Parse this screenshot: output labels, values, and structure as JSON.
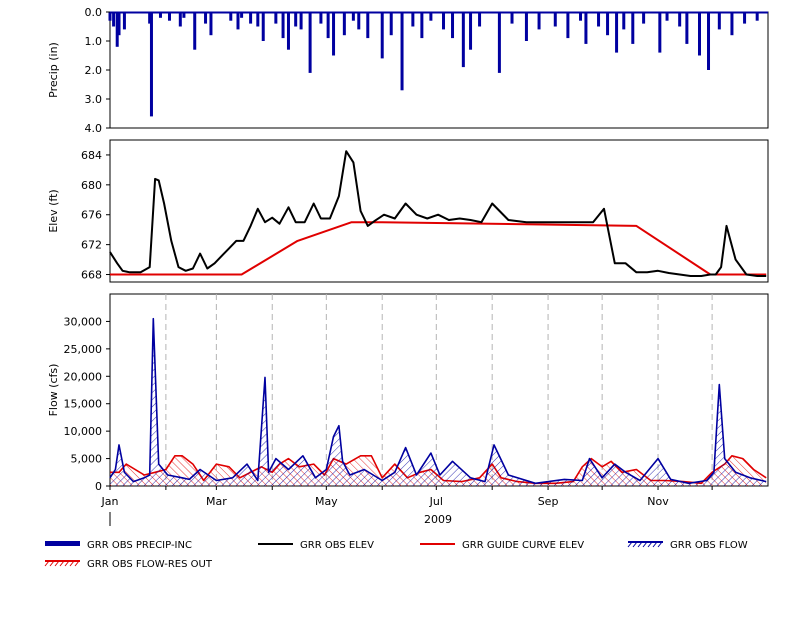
{
  "chart_data": [
    {
      "type": "bar",
      "panel": "precip",
      "ylabel": "Precip (in)",
      "ylim": [
        4.0,
        0.0
      ],
      "inverted_axis": true,
      "y_ticks": [
        "0.0",
        "1.0",
        "2.0",
        "3.0",
        "4.0"
      ],
      "series": [
        {
          "name": "GRR OBS PRECIP-INC",
          "color": "#0000a0",
          "x": [
            "2009-01-01",
            "2009-01-03",
            "2009-01-05",
            "2009-01-06",
            "2009-01-09",
            "2009-01-23",
            "2009-01-24",
            "2009-01-29",
            "2009-02-03",
            "2009-02-09",
            "2009-02-11",
            "2009-02-17",
            "2009-02-23",
            "2009-02-26",
            "2009-03-09",
            "2009-03-13",
            "2009-03-15",
            "2009-03-20",
            "2009-03-24",
            "2009-03-27",
            "2009-04-03",
            "2009-04-07",
            "2009-04-10",
            "2009-04-14",
            "2009-04-17",
            "2009-04-22",
            "2009-04-28",
            "2009-05-02",
            "2009-05-05",
            "2009-05-11",
            "2009-05-16",
            "2009-05-19",
            "2009-05-24",
            "2009-06-01",
            "2009-06-06",
            "2009-06-12",
            "2009-06-18",
            "2009-06-23",
            "2009-06-28",
            "2009-07-05",
            "2009-07-10",
            "2009-07-16",
            "2009-07-20",
            "2009-07-25",
            "2009-08-05",
            "2009-08-12",
            "2009-08-20",
            "2009-08-27",
            "2009-09-05",
            "2009-09-12",
            "2009-09-19",
            "2009-09-22",
            "2009-09-29",
            "2009-10-04",
            "2009-10-09",
            "2009-10-13",
            "2009-10-18",
            "2009-10-24",
            "2009-11-02",
            "2009-11-06",
            "2009-11-13",
            "2009-11-17",
            "2009-11-24",
            "2009-11-29",
            "2009-12-05",
            "2009-12-12",
            "2009-12-19",
            "2009-12-26"
          ],
          "values": [
            0.3,
            0.5,
            1.2,
            0.8,
            0.6,
            0.4,
            3.6,
            0.2,
            0.3,
            0.5,
            0.2,
            1.3,
            0.4,
            0.8,
            0.3,
            0.6,
            0.2,
            0.4,
            0.5,
            1.0,
            0.4,
            0.9,
            1.3,
            0.5,
            0.6,
            2.1,
            0.4,
            0.9,
            1.5,
            0.8,
            0.3,
            0.6,
            0.9,
            1.6,
            0.8,
            2.7,
            0.5,
            0.9,
            0.3,
            0.6,
            0.9,
            1.9,
            1.3,
            0.5,
            2.1,
            0.4,
            1.0,
            0.6,
            0.5,
            0.9,
            0.3,
            1.1,
            0.5,
            0.8,
            1.4,
            0.6,
            1.1,
            0.4,
            1.4,
            0.3,
            0.5,
            1.1,
            1.5,
            2.0,
            0.6,
            0.8,
            0.4,
            0.3
          ]
        }
      ]
    },
    {
      "type": "line",
      "panel": "elevation",
      "ylabel": "Elev (ft)",
      "ylim": [
        667,
        686
      ],
      "y_ticks": [
        "668",
        "672",
        "676",
        "680",
        "684"
      ],
      "series": [
        {
          "name": "GRR OBS ELEV",
          "color": "#000000",
          "x": [
            "2009-01-01",
            "2009-01-05",
            "2009-01-08",
            "2009-01-12",
            "2009-01-18",
            "2009-01-23",
            "2009-01-26",
            "2009-01-28",
            "2009-01-31",
            "2009-02-04",
            "2009-02-08",
            "2009-02-12",
            "2009-02-16",
            "2009-02-20",
            "2009-02-24",
            "2009-02-28",
            "2009-03-04",
            "2009-03-08",
            "2009-03-12",
            "2009-03-16",
            "2009-03-20",
            "2009-03-24",
            "2009-03-28",
            "2009-04-01",
            "2009-04-05",
            "2009-04-10",
            "2009-04-14",
            "2009-04-19",
            "2009-04-24",
            "2009-04-28",
            "2009-05-03",
            "2009-05-08",
            "2009-05-12",
            "2009-05-16",
            "2009-05-20",
            "2009-05-24",
            "2009-05-28",
            "2009-06-02",
            "2009-06-08",
            "2009-06-14",
            "2009-06-20",
            "2009-06-26",
            "2009-07-02",
            "2009-07-08",
            "2009-07-14",
            "2009-07-20",
            "2009-07-26",
            "2009-08-01",
            "2009-08-10",
            "2009-08-20",
            "2009-08-30",
            "2009-09-08",
            "2009-09-16",
            "2009-09-20",
            "2009-09-26",
            "2009-10-02",
            "2009-10-08",
            "2009-10-14",
            "2009-10-20",
            "2009-10-26",
            "2009-11-01",
            "2009-11-07",
            "2009-11-13",
            "2009-11-19",
            "2009-11-25",
            "2009-11-30",
            "2009-12-03",
            "2009-12-06",
            "2009-12-09",
            "2009-12-14",
            "2009-12-20",
            "2009-12-26",
            "2009-12-31"
          ],
          "values": [
            671.0,
            669.5,
            668.5,
            668.3,
            668.3,
            669.0,
            680.8,
            680.6,
            677.5,
            672.5,
            669.0,
            668.5,
            668.8,
            670.8,
            668.8,
            669.5,
            670.5,
            671.5,
            672.5,
            672.5,
            674.5,
            676.8,
            675.0,
            675.6,
            674.8,
            677.0,
            675.0,
            675.0,
            677.5,
            675.5,
            675.5,
            678.5,
            684.5,
            683.0,
            676.5,
            674.5,
            675.2,
            676.0,
            675.5,
            677.5,
            676.0,
            675.5,
            676.0,
            675.3,
            675.5,
            675.3,
            675.0,
            677.5,
            675.3,
            675.0,
            675.0,
            675.0,
            675.0,
            675.0,
            675.0,
            676.8,
            669.5,
            669.5,
            668.3,
            668.3,
            668.5,
            668.2,
            668.0,
            667.8,
            667.8,
            668.0,
            668.0,
            669.0,
            674.5,
            670.0,
            668.0,
            667.8,
            667.8
          ]
        },
        {
          "name": "GRR GUIDE CURVE ELEV",
          "color": "#e00000",
          "x": [
            "2009-01-01",
            "2009-03-15",
            "2009-04-15",
            "2009-05-15",
            "2009-06-01",
            "2009-10-20",
            "2009-11-30",
            "2009-12-31"
          ],
          "values": [
            668.0,
            668.0,
            672.5,
            675.0,
            675.0,
            674.5,
            668.0,
            668.0
          ]
        }
      ]
    },
    {
      "type": "line",
      "panel": "flow",
      "ylabel": "Flow (cfs)",
      "ylim": [
        0,
        35000
      ],
      "y_ticks": [
        "0",
        "5,000",
        "10,000",
        "15,000",
        "20,000",
        "25,000",
        "30,000"
      ],
      "x_ticks": [
        "Jan",
        "Mar",
        "May",
        "Jul",
        "Sep",
        "Nov"
      ],
      "x_year_label": "2009",
      "series": [
        {
          "name": "GRR OBS FLOW",
          "color": "#0000a0",
          "x": [
            "2009-01-01",
            "2009-01-04",
            "2009-01-06",
            "2009-01-09",
            "2009-01-14",
            "2009-01-20",
            "2009-01-23",
            "2009-01-25",
            "2009-01-28",
            "2009-02-02",
            "2009-02-10",
            "2009-02-14",
            "2009-02-20",
            "2009-03-01",
            "2009-03-10",
            "2009-03-18",
            "2009-03-24",
            "2009-03-28",
            "2009-03-30",
            "2009-04-03",
            "2009-04-10",
            "2009-04-18",
            "2009-04-25",
            "2009-05-01",
            "2009-05-05",
            "2009-05-08",
            "2009-05-10",
            "2009-05-14",
            "2009-05-22",
            "2009-06-01",
            "2009-06-08",
            "2009-06-14",
            "2009-06-20",
            "2009-06-28",
            "2009-07-03",
            "2009-07-10",
            "2009-07-20",
            "2009-07-28",
            "2009-08-02",
            "2009-08-10",
            "2009-08-25",
            "2009-09-10",
            "2009-09-20",
            "2009-09-24",
            "2009-10-01",
            "2009-10-08",
            "2009-10-14",
            "2009-10-22",
            "2009-11-01",
            "2009-11-08",
            "2009-11-18",
            "2009-11-28",
            "2009-12-02",
            "2009-12-05",
            "2009-12-08",
            "2009-12-14",
            "2009-12-22",
            "2009-12-31"
          ],
          "values": [
            1500,
            3000,
            7500,
            2500,
            800,
            1500,
            2000,
            30500,
            4000,
            2000,
            1500,
            1200,
            3000,
            1000,
            1500,
            4000,
            1000,
            19800,
            2500,
            5000,
            3000,
            5500,
            1500,
            3000,
            9000,
            11000,
            4500,
            2000,
            3000,
            1000,
            2500,
            7000,
            2000,
            6000,
            2000,
            4500,
            1500,
            800,
            7500,
            2000,
            500,
            1200,
            1000,
            5000,
            1500,
            4000,
            2500,
            1000,
            5000,
            1200,
            500,
            1000,
            2500,
            18500,
            5000,
            2500,
            1500,
            800
          ]
        },
        {
          "name": "GRR OBS FLOW-RES OUT",
          "color": "#e00000",
          "x": [
            "2009-01-01",
            "2009-01-06",
            "2009-01-10",
            "2009-01-20",
            "2009-01-26",
            "2009-02-01",
            "2009-02-06",
            "2009-02-10",
            "2009-02-16",
            "2009-02-22",
            "2009-03-01",
            "2009-03-08",
            "2009-03-14",
            "2009-03-20",
            "2009-03-26",
            "2009-04-01",
            "2009-04-05",
            "2009-04-10",
            "2009-04-16",
            "2009-04-24",
            "2009-04-30",
            "2009-05-05",
            "2009-05-12",
            "2009-05-20",
            "2009-05-26",
            "2009-06-01",
            "2009-06-08",
            "2009-06-15",
            "2009-06-22",
            "2009-06-28",
            "2009-07-05",
            "2009-07-15",
            "2009-07-25",
            "2009-08-01",
            "2009-08-06",
            "2009-08-15",
            "2009-08-25",
            "2009-09-05",
            "2009-09-15",
            "2009-09-20",
            "2009-09-25",
            "2009-10-01",
            "2009-10-06",
            "2009-10-12",
            "2009-10-20",
            "2009-10-28",
            "2009-11-05",
            "2009-11-15",
            "2009-11-25",
            "2009-12-01",
            "2009-12-08",
            "2009-12-12",
            "2009-12-18",
            "2009-12-24",
            "2009-12-31"
          ],
          "values": [
            2500,
            2500,
            4000,
            2000,
            2500,
            3000,
            5500,
            5500,
            4000,
            1000,
            4000,
            3500,
            1500,
            2500,
            3500,
            2500,
            4000,
            5000,
            3500,
            4000,
            2000,
            5000,
            4000,
            5500,
            5500,
            1500,
            4000,
            1500,
            2500,
            3000,
            1000,
            800,
            1500,
            4000,
            1500,
            800,
            500,
            500,
            800,
            3500,
            5000,
            3500,
            4500,
            2500,
            3000,
            1000,
            1000,
            800,
            500,
            2500,
            4000,
            5500,
            5000,
            3000,
            1500
          ]
        }
      ]
    }
  ],
  "legend": {
    "items": [
      {
        "label": "GRR OBS PRECIP-INC",
        "style": "thick-bar",
        "color": "#0000a0"
      },
      {
        "label": "GRR OBS ELEV",
        "style": "line",
        "color": "#000000"
      },
      {
        "label": "GRR GUIDE CURVE ELEV",
        "style": "line",
        "color": "#e00000"
      },
      {
        "label": "GRR OBS FLOW",
        "style": "hatched",
        "color": "#0000a0"
      },
      {
        "label": "GRR OBS FLOW-RES OUT",
        "style": "hatched",
        "color": "#e00000"
      }
    ]
  }
}
